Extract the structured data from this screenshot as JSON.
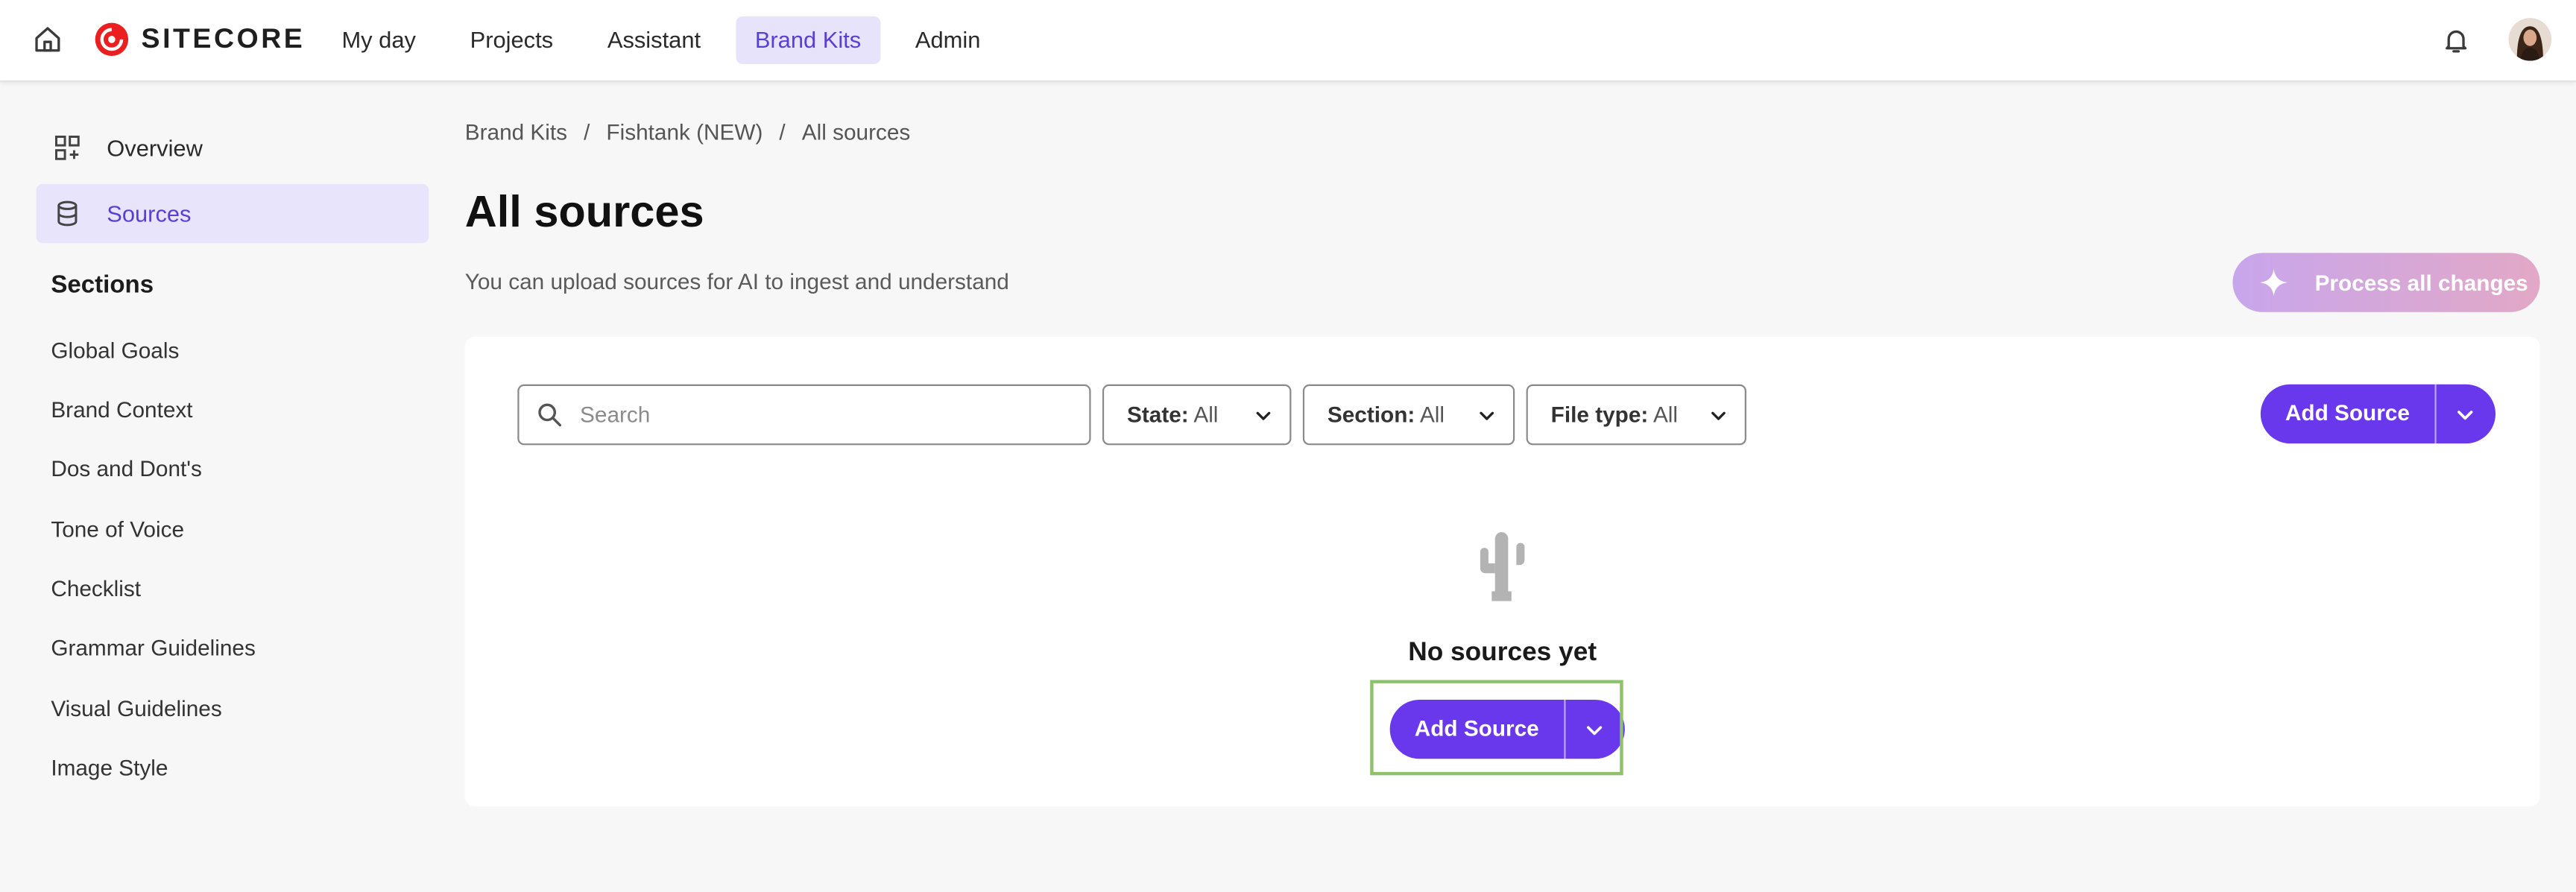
{
  "brand": {
    "name": "SITECORE",
    "color": "#eb1f1f"
  },
  "nav": {
    "items": [
      {
        "label": "My day",
        "active": false
      },
      {
        "label": "Projects",
        "active": false
      },
      {
        "label": "Assistant",
        "active": false
      },
      {
        "label": "Brand Kits",
        "active": true
      },
      {
        "label": "Admin",
        "active": false
      }
    ],
    "icons": {
      "home": "home-icon",
      "notifications": "bell-icon",
      "user": "avatar"
    }
  },
  "sidebar": {
    "links": [
      {
        "label": "Overview",
        "icon": "overview-grid-icon",
        "active": false
      },
      {
        "label": "Sources",
        "icon": "database-icon",
        "active": true
      }
    ],
    "sections_heading": "Sections",
    "sections": [
      {
        "label": "Global Goals"
      },
      {
        "label": "Brand Context"
      },
      {
        "label": "Dos and Dont's"
      },
      {
        "label": "Tone of Voice"
      },
      {
        "label": "Checklist"
      },
      {
        "label": "Grammar Guidelines"
      },
      {
        "label": "Visual Guidelines"
      },
      {
        "label": "Image Style"
      }
    ]
  },
  "breadcrumb": {
    "items": [
      "Brand Kits",
      "Fishtank (NEW)",
      "All sources"
    ],
    "separator": "/"
  },
  "page": {
    "title": "All sources",
    "subtitle": "You can upload sources for AI to ingest and understand",
    "process_button": "Process all changes"
  },
  "toolbar": {
    "search": {
      "placeholder": "Search",
      "value": ""
    },
    "filters": [
      {
        "key": "State:",
        "value": "All"
      },
      {
        "key": "Section:",
        "value": "All"
      },
      {
        "key": "File type:",
        "value": "All"
      }
    ],
    "add_source_label": "Add Source"
  },
  "empty_state": {
    "icon": "cactus-icon",
    "title": "No sources yet",
    "add_source_label": "Add Source"
  },
  "colors": {
    "accent": "#6a38ec",
    "accent_light": "#e8e4fb",
    "nav_active_text": "#5a3fd6",
    "highlight_frame": "#8dc26b"
  }
}
